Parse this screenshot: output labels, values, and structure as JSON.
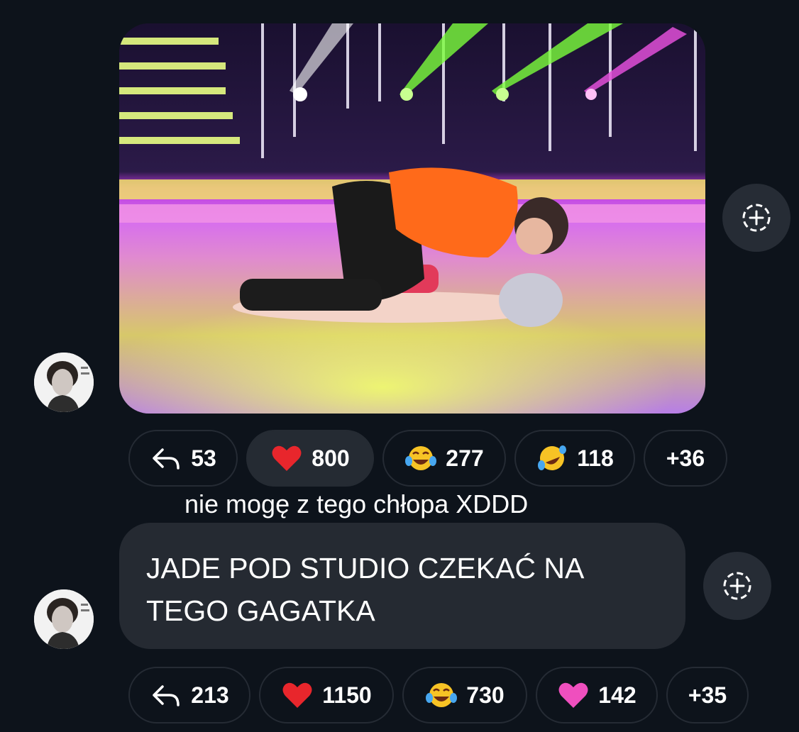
{
  "messages": [
    {
      "type": "image",
      "image_alt": "dancing couple on stage photo",
      "reactions": [
        {
          "icon": "reply-arrow-icon",
          "count": "53"
        },
        {
          "icon": "red-heart-emoji",
          "count": "800",
          "active": true
        },
        {
          "icon": "tears-of-joy-emoji",
          "count": "277"
        },
        {
          "icon": "rofl-emoji",
          "count": "118"
        },
        {
          "icon": "more",
          "count": "+36"
        }
      ],
      "caption": "nie mogę z tego chłopa XDDD"
    },
    {
      "type": "text",
      "text": "JADE POD STUDIO CZEKAĆ NA TEGO GAGATKA",
      "reactions": [
        {
          "icon": "reply-arrow-icon",
          "count": "213"
        },
        {
          "icon": "red-heart-emoji",
          "count": "1150"
        },
        {
          "icon": "tears-of-joy-emoji",
          "count": "730"
        },
        {
          "icon": "pink-heart-emoji",
          "count": "142"
        },
        {
          "icon": "more",
          "count": "+35"
        }
      ]
    }
  ],
  "colors": {
    "background": "#0d131b",
    "bubble": "#252a32",
    "chip_border": "#252b34",
    "share_button": "#262c35"
  }
}
